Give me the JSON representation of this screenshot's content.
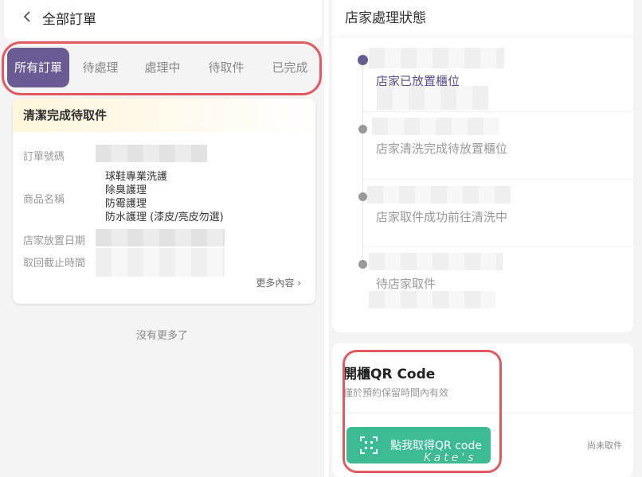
{
  "left": {
    "header": {
      "title": "全部訂單"
    },
    "tabs": [
      {
        "label": "所有訂單",
        "active": true
      },
      {
        "label": "待處理"
      },
      {
        "label": "處理中"
      },
      {
        "label": "待取件"
      },
      {
        "label": "已完成"
      }
    ],
    "order_card": {
      "status_title": "清潔完成待取件",
      "fields": {
        "order_number_label": "訂單號碼",
        "product_label": "商品名稱",
        "placed_date_label": "店家放置日期",
        "pickup_deadline_label": "取回截止時間"
      },
      "products": [
        "球鞋專業洗護",
        "除臭護理",
        "防霉護理",
        "防水護理 (漆皮/亮皮勿選)"
      ],
      "more_link": "更多內容"
    },
    "no_more_text": "沒有更多了"
  },
  "right": {
    "status": {
      "title": "店家處理狀態",
      "steps": [
        {
          "label": "店家已放置櫃位",
          "active": true
        },
        {
          "label": "店家清洗完成待放置櫃位"
        },
        {
          "label": "店家取件成功前往清洗中"
        },
        {
          "label": "待店家取件"
        }
      ]
    },
    "qr": {
      "title": "開櫃QR Code",
      "subtitle": "僅於預約保留時間內有效",
      "button_label": "點我取得QR code",
      "status": "尚未取件"
    }
  },
  "watermark": "Kate's",
  "colors": {
    "accent_purple": "#6b5b95",
    "button_green": "#3dbb94",
    "highlight_red": "#e05a5f"
  }
}
